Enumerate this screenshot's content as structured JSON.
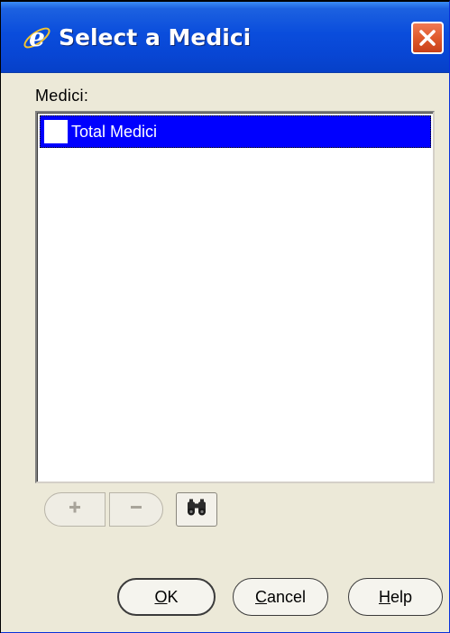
{
  "window": {
    "title": "Select a Medici",
    "icon": "internet-explorer-icon",
    "close_icon": "close-icon"
  },
  "colors": {
    "titlebar": "#0846d4",
    "close_button": "#e05a2c",
    "selection": "#0000ff",
    "dialog_background": "#ece9d8"
  },
  "dimension": {
    "label": "Medici:",
    "list_items": [
      {
        "label": "Total Medici",
        "selected": true
      }
    ]
  },
  "toolbar": {
    "add_icon": "plus-icon",
    "remove_icon": "minus-icon",
    "find_icon": "binoculars-icon"
  },
  "buttons": {
    "ok": {
      "mnemonic": "O",
      "rest": "K"
    },
    "cancel": {
      "mnemonic": "C",
      "rest": "ancel"
    },
    "help": {
      "mnemonic": "H",
      "rest": "elp"
    }
  }
}
